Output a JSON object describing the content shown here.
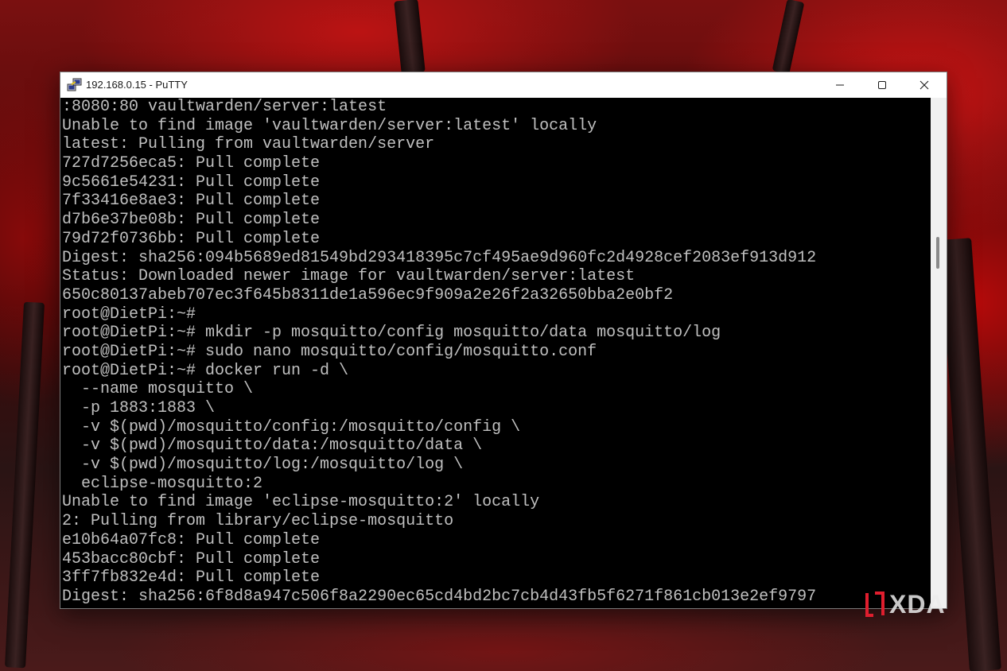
{
  "window": {
    "title": "192.168.0.15 - PuTTY",
    "icon": "putty-icon",
    "controls": {
      "minimize": "minimize-icon",
      "maximize": "maximize-icon",
      "close": "close-icon"
    }
  },
  "terminal": {
    "background": "#000000",
    "foreground": "#c0c0c0",
    "lines": [
      ":8080:80 vaultwarden/server:latest",
      "Unable to find image 'vaultwarden/server:latest' locally",
      "latest: Pulling from vaultwarden/server",
      "727d7256eca5: Pull complete",
      "9c5661e54231: Pull complete",
      "7f33416e8ae3: Pull complete",
      "d7b6e37be08b: Pull complete",
      "79d72f0736bb: Pull complete",
      "Digest: sha256:094b5689ed81549bd293418395c7cf495ae9d960fc2d4928cef2083ef913d912",
      "Status: Downloaded newer image for vaultwarden/server:latest",
      "650c80137abeb707ec3f645b8311de1a596ec9f909a2e26f2a32650bba2e0bf2",
      "root@DietPi:~#",
      "root@DietPi:~# mkdir -p mosquitto/config mosquitto/data mosquitto/log",
      "root@DietPi:~# sudo nano mosquitto/config/mosquitto.conf",
      "root@DietPi:~# docker run -d \\",
      "  --name mosquitto \\",
      "  -p 1883:1883 \\",
      "  -v $(pwd)/mosquitto/config:/mosquitto/config \\",
      "  -v $(pwd)/mosquitto/data:/mosquitto/data \\",
      "  -v $(pwd)/mosquitto/log:/mosquitto/log \\",
      "  eclipse-mosquitto:2",
      "Unable to find image 'eclipse-mosquitto:2' locally",
      "2: Pulling from library/eclipse-mosquitto",
      "e10b64a07fc8: Pull complete",
      "453bacc80cbf: Pull complete",
      "3ff7fb832e4d: Pull complete",
      "Digest: sha256:6f8d8a947c506f8a2290ec65cd4bd2bc7cb4d43fb5f6271f861cb013e2ef9797"
    ]
  },
  "scrollbar": {
    "position_fraction": 0.29
  },
  "watermark": {
    "text": "XDA",
    "color": "#e01e2e"
  }
}
